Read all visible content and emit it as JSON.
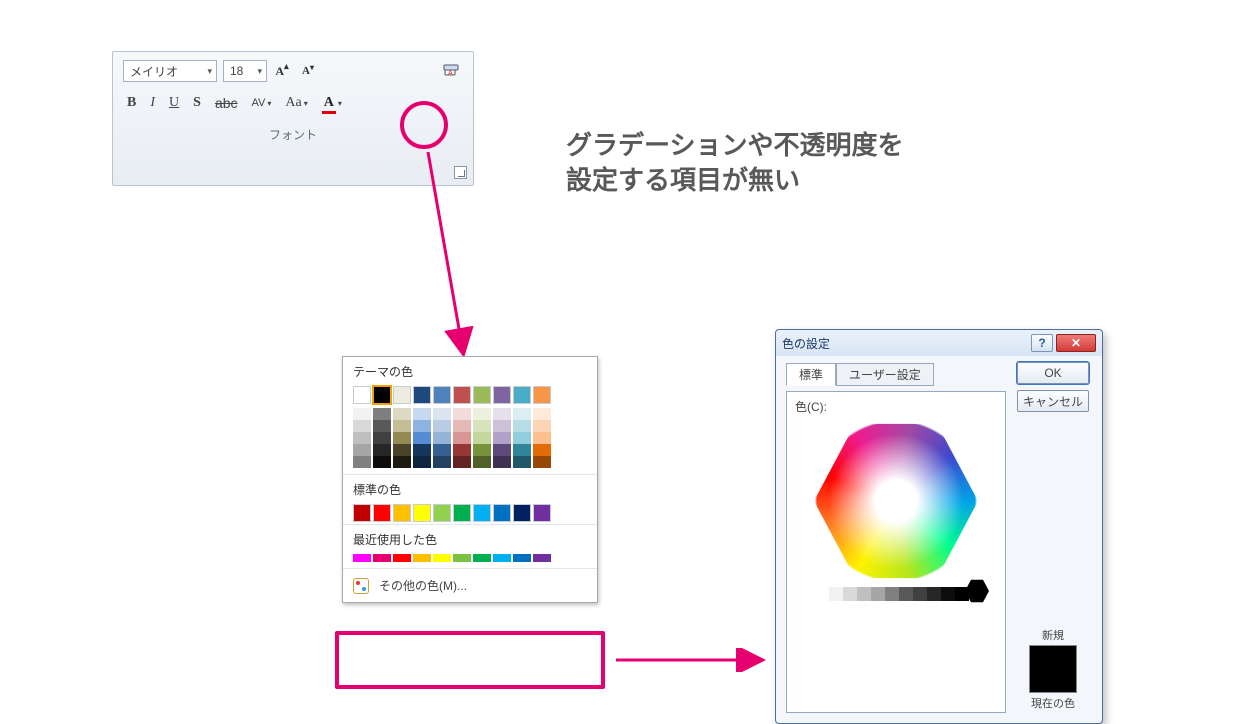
{
  "ribbon": {
    "font_name": "メイリオ",
    "font_size": "18",
    "group_label": "フォント",
    "buttons": {
      "bold": "B",
      "italic": "I",
      "underline": "U",
      "shadow": "S",
      "strike": "abc",
      "av": "AV",
      "aa": "Aa",
      "fontcolor": "A",
      "grow": "A",
      "shrink": "A"
    }
  },
  "annotation": {
    "line1": "グラデーションや不透明度を",
    "line2": "設定する項目が無い"
  },
  "menu": {
    "theme_label": "テーマの色",
    "theme_row": [
      "#ffffff",
      "#000000",
      "#eeece1",
      "#1f497d",
      "#4f81bd",
      "#c0504d",
      "#9bbb59",
      "#8064a2",
      "#4bacc6",
      "#f79646"
    ],
    "shade_cols": [
      [
        "#f2f2f2",
        "#d9d9d9",
        "#bfbfbf",
        "#a6a6a6",
        "#808080"
      ],
      [
        "#7f7f7f",
        "#595959",
        "#404040",
        "#262626",
        "#0d0d0d"
      ],
      [
        "#ddd9c3",
        "#c4bd97",
        "#938953",
        "#494429",
        "#1d1b10"
      ],
      [
        "#c6d9f0",
        "#8db3e2",
        "#548dd4",
        "#17365d",
        "#0f243e"
      ],
      [
        "#dbe5f1",
        "#b8cce4",
        "#95b3d7",
        "#366092",
        "#244061"
      ],
      [
        "#f2dcdb",
        "#e5b9b7",
        "#d99694",
        "#953734",
        "#632423"
      ],
      [
        "#ebf1dd",
        "#d7e3bc",
        "#c3d69b",
        "#76923c",
        "#4f6128"
      ],
      [
        "#e5e0ec",
        "#ccc1d9",
        "#b2a2c7",
        "#5f497a",
        "#3f3151"
      ],
      [
        "#dbeef3",
        "#b7dde8",
        "#92cddc",
        "#31859b",
        "#205867"
      ],
      [
        "#fdeada",
        "#fbd5b5",
        "#fac08f",
        "#e36c09",
        "#974806"
      ]
    ],
    "standard_label": "標準の色",
    "standard_row": [
      "#c00000",
      "#ff0000",
      "#ffc000",
      "#ffff00",
      "#92d050",
      "#00b050",
      "#00b0f0",
      "#0070c0",
      "#002060",
      "#7030a0"
    ],
    "recent_label": "最近使用した色",
    "recent_row": [
      "#ff00ff",
      "#e6006f",
      "#ff0000",
      "#ffbf00",
      "#ffff00",
      "#7ac142",
      "#00b050",
      "#00b0f0",
      "#0070c0",
      "#7030a0"
    ],
    "more_label": "その他の色(M)..."
  },
  "dialog": {
    "title": "色の設定",
    "tab_standard": "標準",
    "tab_custom": "ユーザー設定",
    "color_label": "色(C):",
    "ok": "OK",
    "cancel": "キャンセル",
    "new_label": "新規",
    "current_label": "現在の色",
    "grayscale": [
      "#ffffff",
      "#f2f2f2",
      "#d9d9d9",
      "#bfbfbf",
      "#a6a6a6",
      "#808080",
      "#595959",
      "#404040",
      "#262626",
      "#0d0d0d",
      "#000000"
    ]
  }
}
